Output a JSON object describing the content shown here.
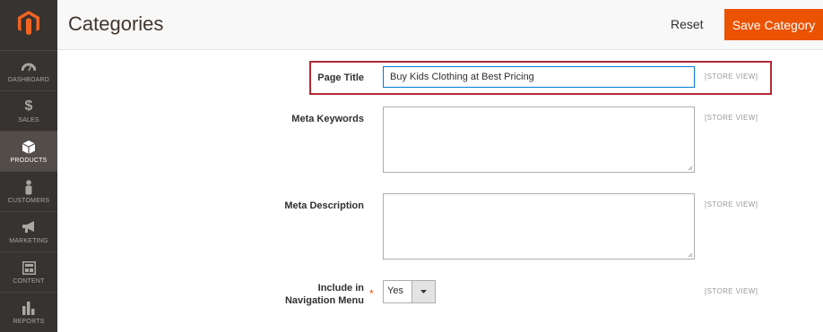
{
  "sidebar": {
    "items": [
      {
        "label": "DASHBOARD",
        "icon": "dashboard-icon"
      },
      {
        "label": "SALES",
        "icon": "dollar-icon"
      },
      {
        "label": "PRODUCTS",
        "icon": "cube-icon"
      },
      {
        "label": "CUSTOMERS",
        "icon": "person-icon"
      },
      {
        "label": "MARKETING",
        "icon": "megaphone-icon"
      },
      {
        "label": "CONTENT",
        "icon": "layout-icon"
      },
      {
        "label": "REPORTS",
        "icon": "bar-chart-icon"
      }
    ],
    "active": "PRODUCTS"
  },
  "header": {
    "title": "Categories",
    "reset_label": "Reset",
    "save_label": "Save Category"
  },
  "form": {
    "page_title": {
      "label": "Page Title",
      "value": "Buy Kids Clothing at Best Pricing",
      "scope": "[STORE VIEW]"
    },
    "meta_keywords": {
      "label": "Meta Keywords",
      "value": "",
      "scope": "[STORE VIEW]"
    },
    "meta_description": {
      "label": "Meta Description",
      "value": "",
      "scope": "[STORE VIEW]"
    },
    "include_in_menu": {
      "label_line1": "Include in",
      "label_line2": "Navigation Menu",
      "required_mark": "*",
      "value": "Yes",
      "scope": "[STORE VIEW]"
    }
  },
  "colors": {
    "sidebar_bg": "#373330",
    "accent": "#eb5202",
    "highlight_border": "#b22a33",
    "focus_border": "#007bdb"
  }
}
